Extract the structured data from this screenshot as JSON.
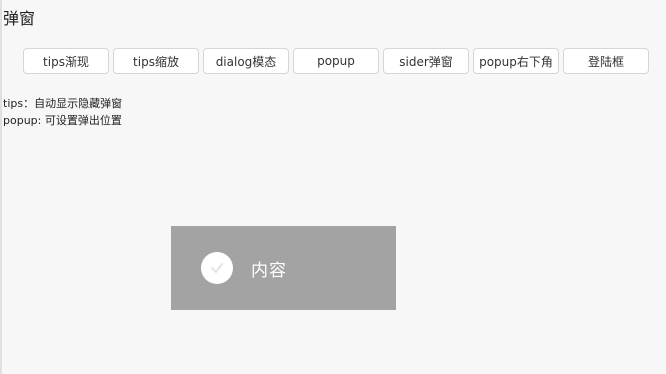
{
  "page": {
    "title": "弹窗"
  },
  "buttons": [
    {
      "label": "tips渐现"
    },
    {
      "label": "tips缩放"
    },
    {
      "label": "dialog模态"
    },
    {
      "label": "popup"
    },
    {
      "label": "sider弹窗"
    },
    {
      "label": "popup右下角"
    },
    {
      "label": "登陆框"
    }
  ],
  "description": {
    "line1": "tips：自动显示隐藏弹窗",
    "line2": "popup: 可设置弹出位置"
  },
  "toast": {
    "text": "内容",
    "icon": "check-circle-icon",
    "background": "#a3a3a3"
  }
}
